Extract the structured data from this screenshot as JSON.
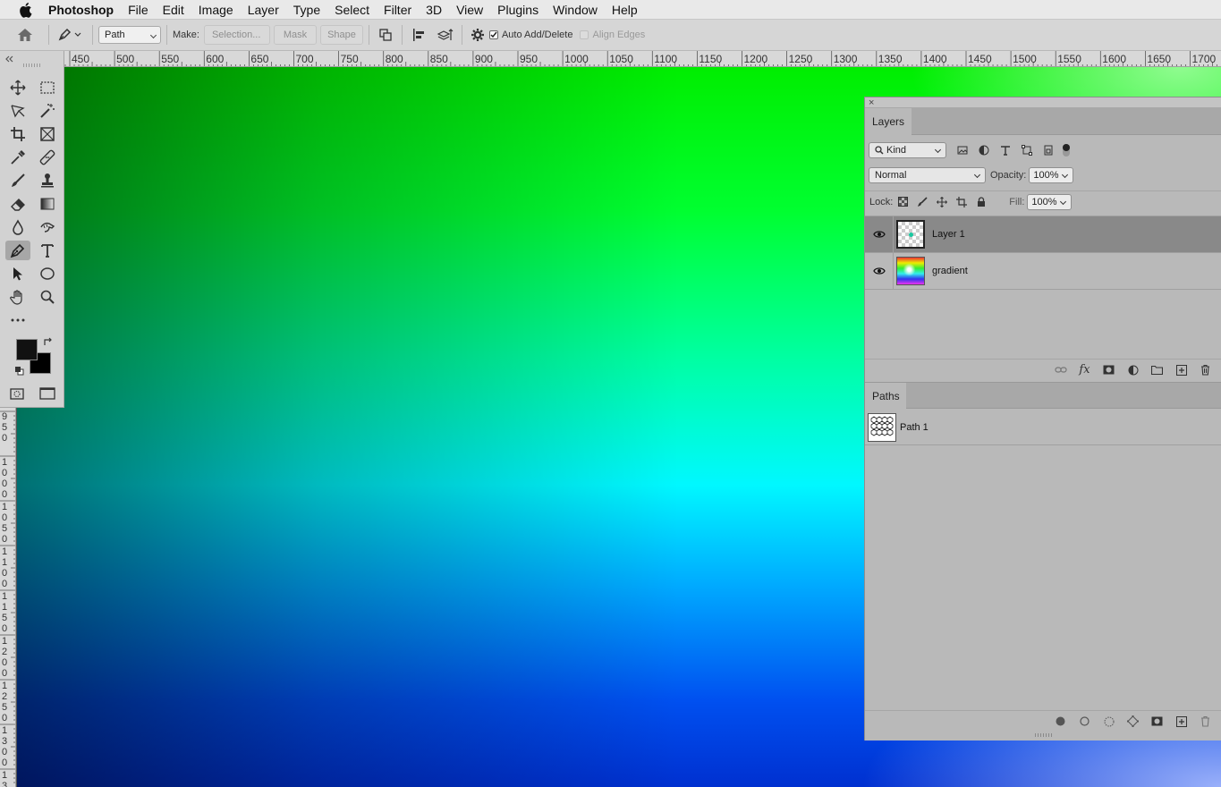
{
  "menubar": {
    "apple_icon": "apple-logo-icon",
    "app_name": "Photoshop",
    "items": [
      "File",
      "Edit",
      "Image",
      "Layer",
      "Type",
      "Select",
      "Filter",
      "3D",
      "View",
      "Plugins",
      "Window",
      "Help"
    ]
  },
  "options_bar": {
    "mode_select": "Path",
    "make_label": "Make:",
    "selection_btn": "Selection...",
    "mask_btn": "Mask",
    "shape_btn": "Shape",
    "auto_add_delete_label": "Auto Add/Delete",
    "auto_add_delete_checked": true,
    "align_edges_label": "Align Edges",
    "align_edges_checked": false
  },
  "ruler": {
    "horizontal_ticks": [
      "450",
      "500",
      "550",
      "600",
      "650",
      "700",
      "750",
      "800",
      "850",
      "900",
      "950",
      "1000",
      "1050",
      "1100",
      "1150",
      "1200",
      "1250",
      "1300",
      "1350",
      "1400",
      "1450",
      "1500",
      "1550",
      "1600",
      "1650",
      "1700"
    ],
    "vertical_labels": [
      [
        "9",
        "5",
        "0"
      ],
      [
        "1",
        "0",
        "0",
        "0"
      ],
      [
        "1",
        "0",
        "5",
        "0"
      ],
      [
        "1",
        "1",
        "0",
        "0"
      ],
      [
        "1",
        "1",
        "5",
        "0"
      ],
      [
        "1",
        "2",
        "0",
        "0"
      ],
      [
        "1",
        "2",
        "5",
        "0"
      ],
      [
        "1",
        "3",
        "0",
        "0"
      ],
      [
        "1",
        "3"
      ]
    ]
  },
  "toolbox": {
    "tools": [
      "move-tool",
      "marquee-tool",
      "lasso-tool",
      "magic-wand-tool",
      "crop-tool",
      "frame-tool",
      "eyedropper-tool",
      "healing-brush-tool",
      "brush-tool",
      "stamp-tool",
      "eraser-tool",
      "gradient-tool",
      "blur-tool",
      "smudge-tool",
      "pen-tool",
      "type-tool",
      "path-selection-tool",
      "ellipse-tool",
      "hand-tool",
      "zoom-tool"
    ],
    "active_tool": "pen-tool",
    "foreground_color": "#111111",
    "background_color": "#000000"
  },
  "layers_panel": {
    "tab_label": "Layers",
    "filter_kind": "Kind",
    "blend_mode": "Normal",
    "opacity_label": "Opacity:",
    "opacity_value": "100%",
    "lock_label": "Lock:",
    "fill_label": "Fill:",
    "fill_value": "100%",
    "layers": [
      {
        "name": "Layer 1",
        "selected": true,
        "visible": true
      },
      {
        "name": "gradient",
        "selected": false,
        "visible": true
      }
    ]
  },
  "paths_panel": {
    "tab_label": "Paths",
    "paths": [
      {
        "name": "Path 1"
      }
    ]
  }
}
